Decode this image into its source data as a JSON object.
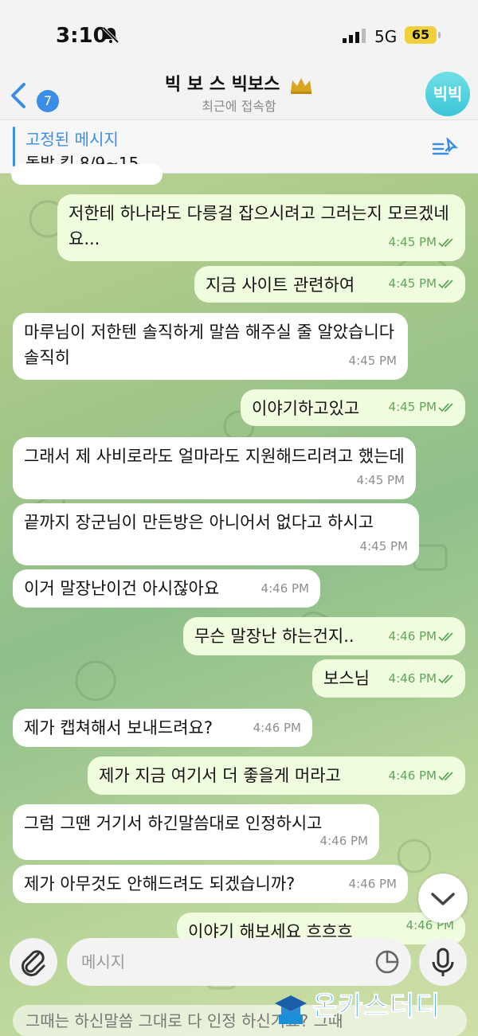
{
  "status": {
    "time": "3:10",
    "network": "5G",
    "battery": "65"
  },
  "header": {
    "back_badge": "7",
    "title": "빅 보 스 빅보스",
    "subtitle": "최근에 접속함",
    "avatar_text": "빅빅"
  },
  "pinned": {
    "title": "고정된 메시지",
    "text": "돌발 킵 8/9~15"
  },
  "messages": [
    {
      "side": "out",
      "text": "저한테 하나라도 다릉걸 잡으시려고 그러는지 모르겠네요...",
      "time": "4:45 PM"
    },
    {
      "side": "out",
      "text": "지금 사이트 관련하여",
      "time": "4:45 PM"
    },
    {
      "side": "in",
      "text": "마루님이 저한텐 솔직하게 말씀 해주실 줄 알았습니다 솔직히",
      "time": "4:45 PM"
    },
    {
      "side": "out",
      "text": "이야기하고있고",
      "time": "4:45 PM"
    },
    {
      "side": "in",
      "text": "그래서 제 사비로라도 얼마라도 지원해드리려고 했는데",
      "time": "4:45 PM"
    },
    {
      "side": "in",
      "text": "끝까지 장군님이 만든방은 아니어서 없다고 하시고",
      "time": "4:45 PM"
    },
    {
      "side": "in",
      "text": "이거 말장난이건 아시잖아요",
      "time": "4:46 PM"
    },
    {
      "side": "out",
      "text": "무슨 말장난 하는건지..",
      "time": "4:46 PM"
    },
    {
      "side": "out",
      "text": "보스님",
      "time": "4:46 PM"
    },
    {
      "side": "in",
      "text": "제가 캡쳐해서 보내드려요?",
      "time": "4:46 PM"
    },
    {
      "side": "out",
      "text": "제가 지금 여기서 더 좋을게 머라고",
      "time": "4:46 PM"
    },
    {
      "side": "in",
      "text": "그럼 그땐 거기서 하긴말씀대로 인정하시고",
      "time": "4:46 PM"
    },
    {
      "side": "in",
      "text": "제가 아무것도 안해드려도 되겠습니까?",
      "time": "4:46 PM"
    },
    {
      "side": "out",
      "text": "이야기 해보세요 흐흐흐",
      "time": "4:46 PM"
    }
  ],
  "composer": {
    "placeholder": "메시지"
  },
  "ghost_text": "그때는 하신말씀 그대로 다 인정 하신거죠? 그때",
  "watermark": "온카스터디",
  "colors": {
    "accent": "#3b8ee6",
    "outgoing_bubble": "#effdde",
    "incoming_bubble": "#ffffff",
    "check": "#5fa55a"
  }
}
